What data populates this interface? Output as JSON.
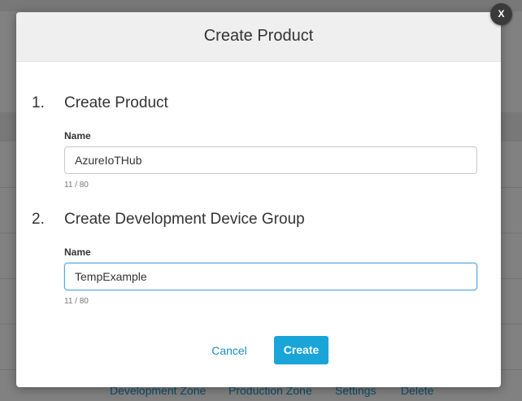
{
  "background": {
    "tabs": [
      "Development Zone",
      "Production Zone",
      "Settings",
      "Delete"
    ]
  },
  "modal": {
    "title": "Create Product",
    "close_label": "X",
    "sections": [
      {
        "number": "1.",
        "title": "Create Product",
        "field_label": "Name",
        "value": "AzureIoTHub",
        "char_count": "11 / 80"
      },
      {
        "number": "2.",
        "title": "Create Development Device Group",
        "field_label": "Name",
        "value": "TempExample",
        "char_count": "11 / 80"
      }
    ],
    "cancel_label": "Cancel",
    "create_label": "Create"
  },
  "colors": {
    "accent": "#1aa5d8",
    "link": "#1b8fc4",
    "focus_border": "#5aa9de"
  }
}
